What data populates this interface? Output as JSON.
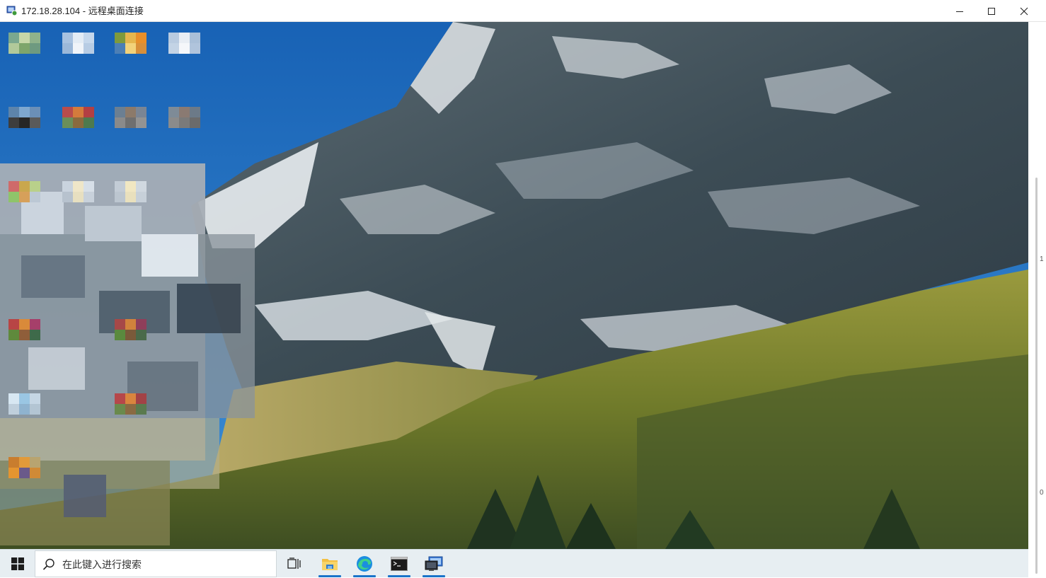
{
  "window": {
    "title": "172.18.28.104 - 远程桌面连接",
    "app_icon": "remote-desktop-icon",
    "controls": {
      "minimize_icon": "minimize-icon",
      "maximize_icon": "maximize-icon",
      "close_icon": "close-icon"
    }
  },
  "desktop": {
    "wallpaper": "mountain-landscape",
    "icons_obscured": true
  },
  "taskbar": {
    "start_icon": "windows-start-icon",
    "search_placeholder": "在此键入进行搜索",
    "pinned": [
      {
        "name": "task-view-icon",
        "active": false
      },
      {
        "name": "file-explorer-icon",
        "active": true
      },
      {
        "name": "edge-browser-icon",
        "active": true
      },
      {
        "name": "command-prompt-icon",
        "active": true
      },
      {
        "name": "remote-desktop-icon",
        "active": true
      }
    ]
  },
  "colors": {
    "accent": "#1a73c9",
    "taskbar_bg": "#e7eef2",
    "titlebar_bg": "#ffffff"
  }
}
